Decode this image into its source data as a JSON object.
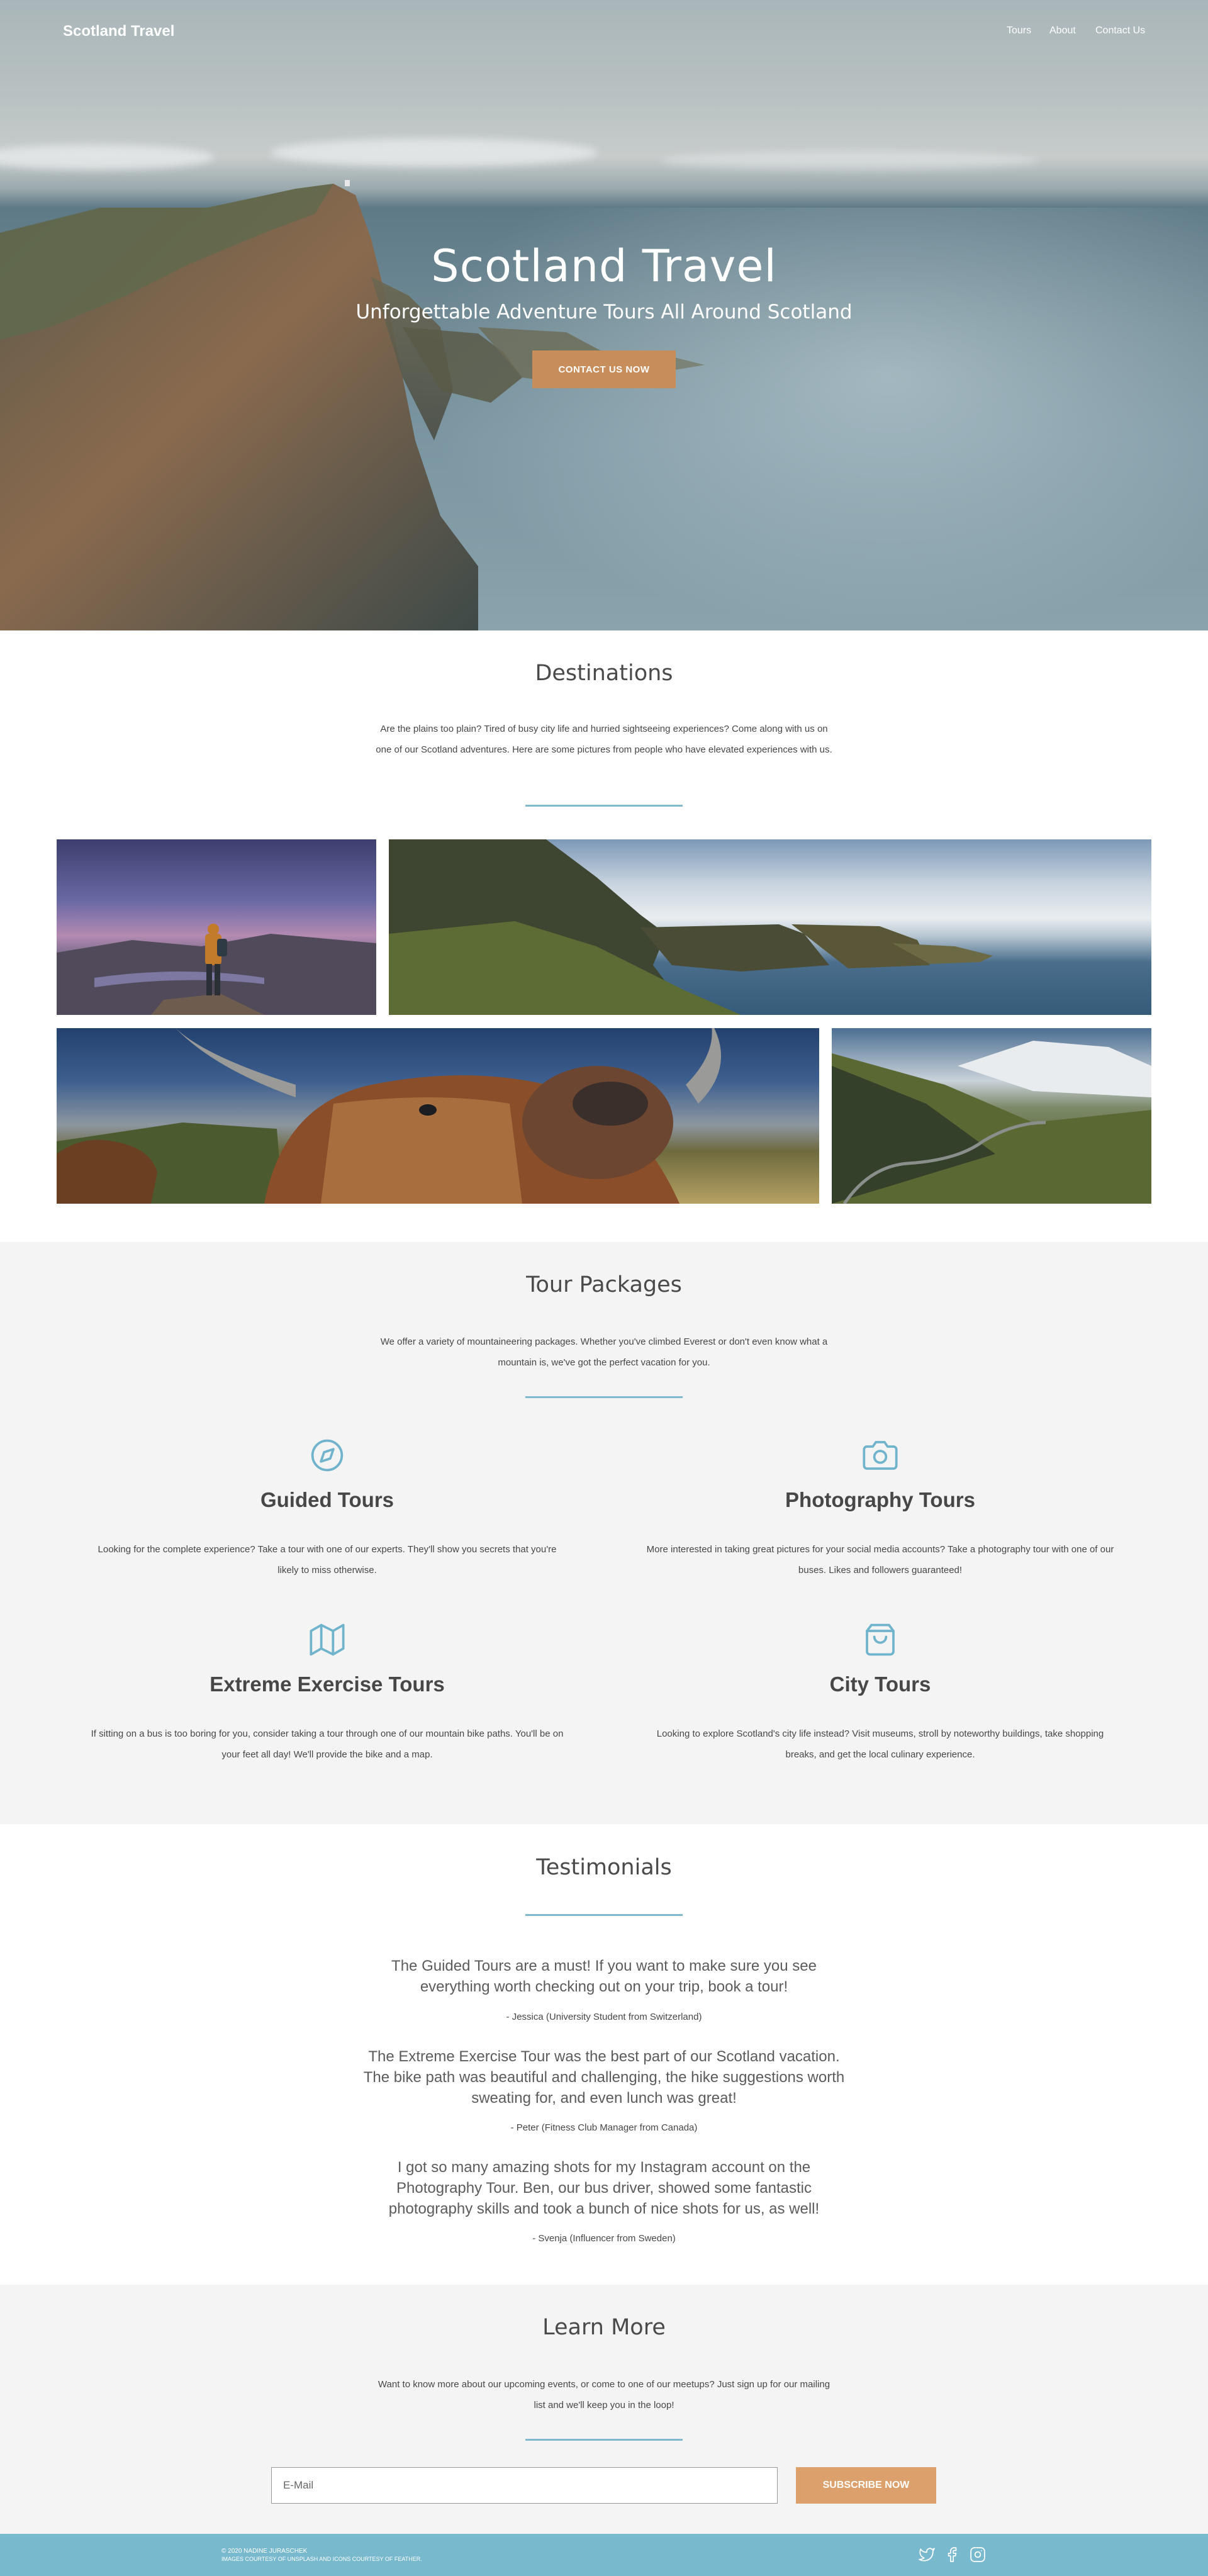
{
  "brand": "Scotland Travel",
  "nav": [
    {
      "label": "Tours"
    },
    {
      "label": "About"
    },
    {
      "label": "Contact Us"
    }
  ],
  "hero": {
    "title": "Scotland Travel",
    "subtitle": "Unforgettable Adventure Tours All Around Scotland",
    "cta": "CONTACT US NOW"
  },
  "destinations": {
    "title": "Destinations",
    "text": "Are the plains too plain? Tired of busy city life and hurried sightseeing experiences? Come along with us on one of our Scotland adventures. Here are some pictures from people who have elevated experiences with us."
  },
  "packages": {
    "title": "Tour Packages",
    "text": "We offer a variety of mountaineering packages. Whether you've climbed Everest or don't even know what a mountain is, we've got the perfect vacation for you.",
    "items": [
      {
        "icon": "compass-icon",
        "title": "Guided Tours",
        "text": "Looking for the complete experience? Take a tour with one of our experts. They'll show you secrets that you're likely to miss otherwise."
      },
      {
        "icon": "camera-icon",
        "title": "Photography Tours",
        "text": "More interested in taking great pictures for your social media accounts? Take a photography tour with one of our buses. Likes and followers guaranteed!"
      },
      {
        "icon": "map-icon",
        "title": "Extreme Exercise Tours",
        "text": "If sitting on a bus is too boring for you, consider taking a tour through one of our mountain bike paths. You'll be on your feet all day! We'll provide the bike and a map."
      },
      {
        "icon": "shopping-bag-icon",
        "title": "City Tours",
        "text": "Looking to explore Scotland's city life instead? Visit museums, stroll by noteworthy buildings, take shopping breaks, and get the local culinary experience."
      }
    ]
  },
  "testimonials": {
    "title": "Testimonials",
    "items": [
      {
        "quote": "The Guided Tours are a must! If you want to make sure you see everything worth checking out on your trip, book a tour!",
        "author": "- Jessica (University Student from Switzerland)"
      },
      {
        "quote": "The Extreme Exercise Tour was the best part of our Scotland vacation. The bike path was beautiful and challenging, the hike suggestions worth sweating for, and even lunch was great!",
        "author": "- Peter (Fitness Club Manager from Canada)"
      },
      {
        "quote": "I got so many amazing shots for my Instagram account on the Photography Tour. Ben, our bus driver, showed some fantastic photography skills and took a bunch of nice shots for us, as well!",
        "author": "- Svenja (Influencer from Sweden)"
      }
    ]
  },
  "learn": {
    "title": "Learn More",
    "text": "Want to know more about our upcoming events, or come to one of our meetups? Just sign up for our mailing list and we'll keep you in the loop!",
    "email_placeholder": "E-Mail",
    "subscribe": "SUBSCRIBE NOW"
  },
  "footer": {
    "copyright": "© 2020 NADINE JURASCHEK",
    "credits": "IMAGES COURTESY OF UNSPLASH AND ICONS COURTESY OF FEATHER."
  },
  "colors": {
    "accent": "#c78e5c",
    "rule": "#7fb9cf",
    "footer": "#79b9cd",
    "icon": "#6fb3cc",
    "section_gray": "#f4f4f4"
  }
}
